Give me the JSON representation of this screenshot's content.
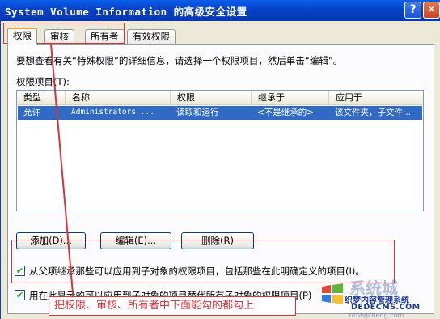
{
  "window": {
    "title": "System Volume Information 的高级安全设置",
    "help_label": "?",
    "close_label": "✕"
  },
  "tabs": [
    {
      "label": "权限",
      "active": true
    },
    {
      "label": "审核",
      "active": false
    },
    {
      "label": "所有者",
      "active": false
    },
    {
      "label": "有效权限",
      "active": false
    }
  ],
  "panel": {
    "intro": "要想查看有关“特殊权限”的详细信息，请选择一个权限项目，然后单击“编辑”。",
    "entries_label": "权限项目(T):"
  },
  "table": {
    "columns": [
      "类型",
      "名称",
      "权限",
      "继承于",
      "应用于"
    ],
    "rows": [
      [
        "允许",
        "Administrators ...",
        "读取和运行",
        "<不是继承的>",
        "该文件夹，子文件..."
      ]
    ]
  },
  "buttons": {
    "add": "添加(D)...",
    "edit": "编辑(E)...",
    "remove": "删除(R)"
  },
  "checkboxes": {
    "inherit": {
      "label": "从父项继承那些可以应用到子对象的权限项目，包括那些在此明确定义的项目(I)。",
      "checked": true
    },
    "replace": {
      "label": "用在此显示的可以应用到子对象的项目替代所有子对象的权限项目(P)",
      "checked": true
    }
  },
  "annotation": {
    "note": "把权限、审核、所有者中下面能勾的都勾上",
    "color": "#d8343a"
  },
  "watermark": {
    "big": "系统城",
    "line1": "织梦内容管理系统",
    "line2": "DEDECMS.COM",
    "line3": "xitongcheng.com"
  },
  "colors": {
    "titlebar": "#0842c8",
    "selection": "#316ac5",
    "tab_highlight": "#f2a23a"
  }
}
